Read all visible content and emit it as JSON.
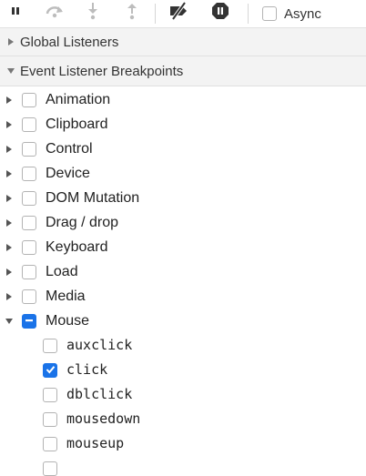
{
  "toolbar": {
    "buttons": [
      {
        "icon": "pause-icon",
        "enabled": true
      },
      {
        "icon": "step-over-icon",
        "enabled": false
      },
      {
        "icon": "step-into-icon",
        "enabled": false
      },
      {
        "icon": "step-out-icon",
        "enabled": false
      },
      {
        "icon": "deactivate-breakpoints-icon",
        "enabled": true
      },
      {
        "icon": "pause-on-exceptions-icon",
        "enabled": true
      }
    ],
    "async_label": "Async",
    "async_checked": false
  },
  "sections": {
    "global_listeners": {
      "label": "Global Listeners",
      "expanded": false
    },
    "event_listener_breakpoints": {
      "label": "Event Listener Breakpoints",
      "expanded": true
    }
  },
  "categories": [
    {
      "label": "Animation",
      "expanded": false,
      "state": "unchecked"
    },
    {
      "label": "Clipboard",
      "expanded": false,
      "state": "unchecked"
    },
    {
      "label": "Control",
      "expanded": false,
      "state": "unchecked"
    },
    {
      "label": "Device",
      "expanded": false,
      "state": "unchecked"
    },
    {
      "label": "DOM Mutation",
      "expanded": false,
      "state": "unchecked"
    },
    {
      "label": "Drag / drop",
      "expanded": false,
      "state": "unchecked"
    },
    {
      "label": "Keyboard",
      "expanded": false,
      "state": "unchecked"
    },
    {
      "label": "Load",
      "expanded": false,
      "state": "unchecked"
    },
    {
      "label": "Media",
      "expanded": false,
      "state": "unchecked"
    },
    {
      "label": "Mouse",
      "expanded": true,
      "state": "mixed"
    }
  ],
  "mouse_events": [
    {
      "label": "auxclick",
      "checked": false
    },
    {
      "label": "click",
      "checked": true
    },
    {
      "label": "dblclick",
      "checked": false
    },
    {
      "label": "mousedown",
      "checked": false
    },
    {
      "label": "mouseup",
      "checked": false
    }
  ],
  "colors": {
    "accent": "#1a73e8",
    "section_bg": "#f3f3f3",
    "icon_dark": "#333333",
    "icon_disabled": "#bdbdbd"
  }
}
